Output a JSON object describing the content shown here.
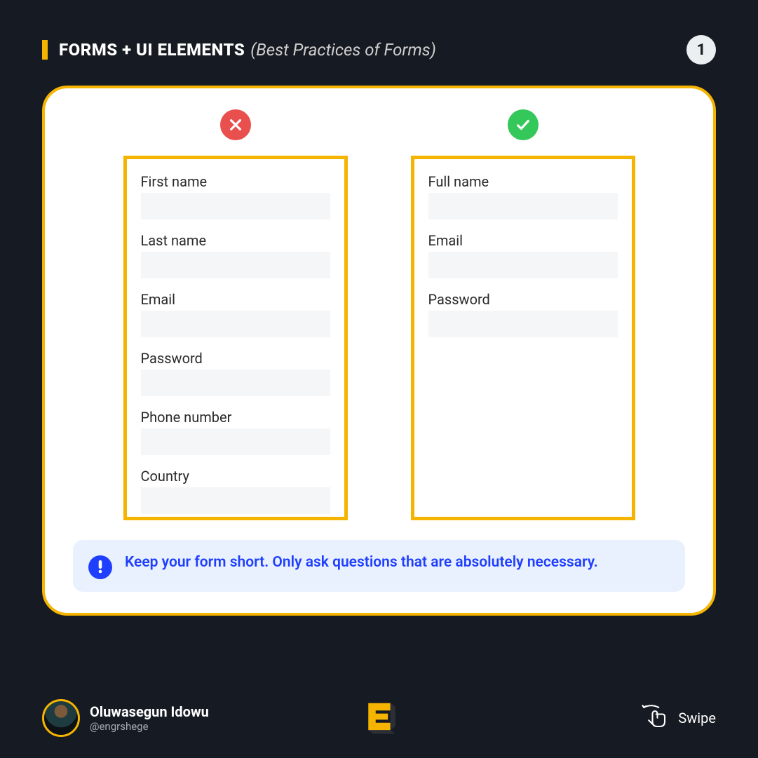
{
  "header": {
    "title_main": "FORMS + UI ELEMENTS",
    "title_sub": "(Best Practices of Forms)",
    "page_number": "1"
  },
  "forms": {
    "bad": {
      "status": "cross",
      "fields": [
        "First name",
        "Last name",
        "Email",
        "Password",
        "Phone number",
        "Country"
      ]
    },
    "good": {
      "status": "check",
      "fields": [
        "Full name",
        "Email",
        "Password"
      ]
    }
  },
  "tip": {
    "text": "Keep your form short. Only ask questions that are absolutely necessary."
  },
  "footer": {
    "author_name": "Oluwasegun Idowu",
    "author_handle": "@engrshege",
    "swipe_label": "Swipe"
  }
}
